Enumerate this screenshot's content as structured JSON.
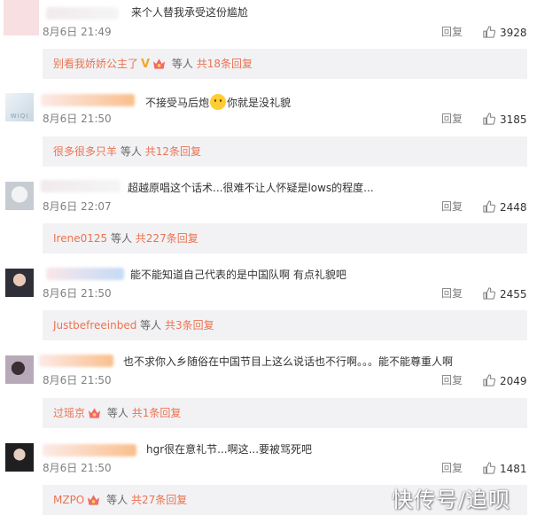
{
  "comments": [
    {
      "text": "来个人替我承受这份尴尬",
      "time": "8月6日 21:49",
      "reply_label": "回复",
      "likes": "3928",
      "replies": {
        "user": "别看我娇娇公主了",
        "badge": "V",
        "suffix_grey": "等人",
        "count_text": "共18条回复"
      }
    },
    {
      "text_before_emoji": "不接受马后炮",
      "text_after_emoji": "你就是没礼貌",
      "time": "8月6日 21:50",
      "reply_label": "回复",
      "likes": "3185",
      "replies": {
        "user": "很多很多只羊",
        "suffix_grey": "等人",
        "count_text": "共12条回复"
      }
    },
    {
      "text": "超越原唱这个话术...很难不让人怀疑是lows的程度...",
      "time": "8月6日 22:07",
      "reply_label": "回复",
      "likes": "2448",
      "replies": {
        "user": "Irene0125",
        "suffix_grey": "等人",
        "count_text": "共227条回复"
      }
    },
    {
      "text": "能不能知道自己代表的是中国队啊 有点礼貌吧",
      "time": "8月6日 21:50",
      "reply_label": "回复",
      "likes": "2455",
      "replies": {
        "user": "Justbefreeinbed",
        "suffix_grey": "等人",
        "count_text": "共3条回复"
      }
    },
    {
      "text": "也不求你入乡随俗在中国节目上这么说话也不行啊。。。能不能尊重人啊",
      "time": "8月6日 21:50",
      "reply_label": "回复",
      "likes": "2049",
      "replies": {
        "user": "过瑶京",
        "suffix_grey": "等人",
        "count_text": "共1条回复"
      }
    },
    {
      "text": "hgr很在意礼节...啊这...要被骂死吧",
      "time": "8月6日 21:50",
      "reply_label": "回复",
      "likes": "1481",
      "replies": {
        "user": "MZPO",
        "suffix_grey": "等人",
        "count_text": "共27条回复"
      }
    }
  ],
  "avatar_watermark": "WIQI",
  "watermark": "快传号/追呗",
  "colors": {
    "link": "#eb7350",
    "reply_bg": "#f2f2f5",
    "meta": "#808080"
  }
}
